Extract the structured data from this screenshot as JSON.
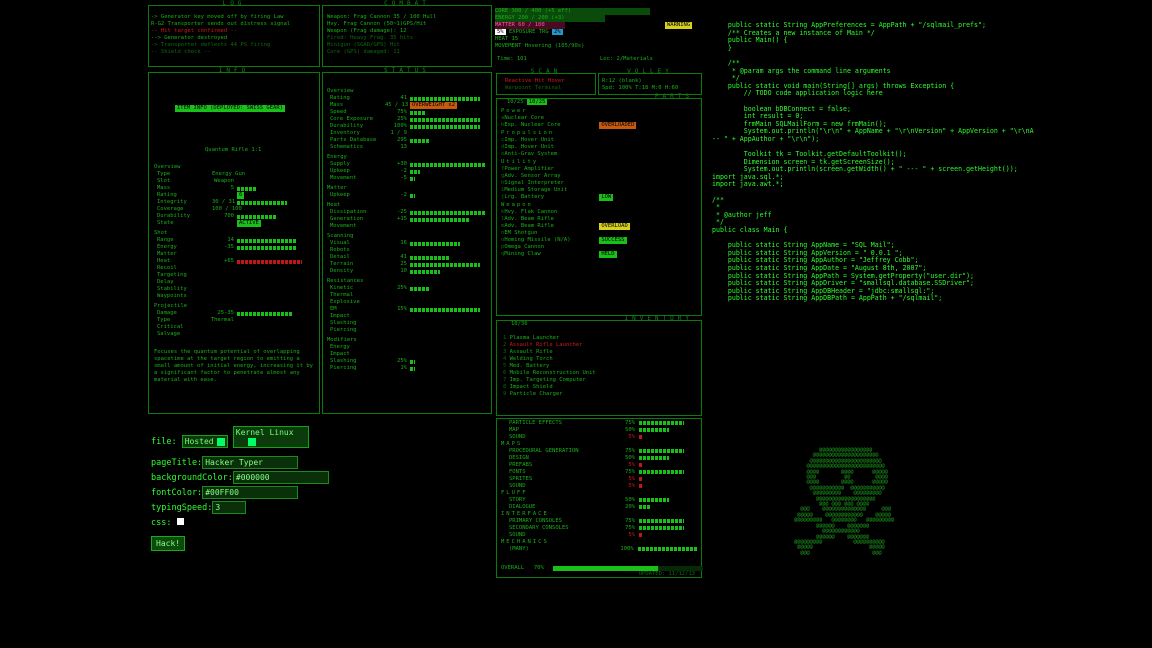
{
  "log": {
    "title": "LOG",
    "lines": [
      "-> Generator key moved off by firing Law",
      "R-G2 Transporter sends out distress signal",
      "-- Hit target confirmed --",
      "--> Generator destroyed",
      "-> Transporter deflects 44 PS firing",
      "-- Shield check --"
    ]
  },
  "combat": {
    "title": "COMBAT",
    "lines": [
      "Weapon: Frag Cannon 35 / 100 Hull",
      "Hvy. Frag Cannon (50~1)GPS/Hit",
      "Weapon (Frag damage): 12",
      "Fired: Heavy Frag. 35 hits",
      "Minigun (SGAD/GPS) Hit",
      "Core (GPS) damaged: 11"
    ]
  },
  "status_top": {
    "lines": [
      "CORE  300 / 400 (+5 eff)",
      "ENERGY 200 / 200 (+3)",
      "MATTER 60 / 100",
      "EXPOSURE  TRG",
      "HEAT  15",
      "MOVEMENT Hovering (105/90s)"
    ],
    "badge_5": "5%",
    "badge_2": "2%",
    "warning": "WARNING",
    "time": "Time: 101",
    "loc": "Loc: 2/Materials"
  },
  "scan": {
    "title": "SCAN",
    "lines": [
      "Reactive Hit Hover",
      "Warpoint Terminal"
    ]
  },
  "volley": {
    "title": "VOLLEY",
    "lines": [
      "R:12 (blank)",
      "Spd: 100%  T:18  M:0  H:60"
    ]
  },
  "info": {
    "title": "INFO",
    "badge": "ITEM INFO (DEPLOYED: SWISS GEAR)",
    "name": "Quantum Rifle 1:1",
    "overview_h": "Overview",
    "overview": [
      [
        "Type",
        "Energy Gun"
      ],
      [
        "Slot",
        "Weapon"
      ],
      [
        "Mass",
        "5"
      ],
      [
        "Rating",
        "6"
      ],
      [
        "Integrity",
        "30 / 31"
      ],
      [
        "Coverage",
        "100 / 100"
      ],
      [
        "Durability",
        "700"
      ],
      [
        "State",
        "ACTIVE"
      ]
    ],
    "shot_h": "Shot",
    "shot": [
      [
        "Range",
        "14"
      ],
      [
        "Energy",
        "-35"
      ],
      [
        "Matter",
        ""
      ],
      [
        "Heat",
        "+65"
      ],
      [
        "Recoil",
        ""
      ],
      [
        "Targeting",
        ""
      ],
      [
        "Delay",
        ""
      ],
      [
        "Stability",
        ""
      ],
      [
        "Waypoints",
        ""
      ]
    ],
    "projectile_h": "Projectile",
    "projectile": [
      [
        "Damage",
        "25-35"
      ],
      [
        "Type",
        "Thermal"
      ],
      [
        "Critical",
        ""
      ],
      [
        "Salvage",
        ""
      ]
    ],
    "desc": "Focuses the quantum potential of overlapping spacetime at the target region to emitting a small amount of initial energy, increasing it by a significant factor to penetrate almost any material with ease."
  },
  "status": {
    "title": "STATUS",
    "overview_h": "Overview",
    "overview": [
      [
        "Rating",
        "41"
      ],
      [
        "Mass",
        "45 / 13"
      ],
      [
        "Speed",
        "75%"
      ],
      [
        "Core Exposure",
        "25%"
      ],
      [
        "Durability",
        "100%"
      ],
      [
        "Inventory",
        "1 / 9"
      ],
      [
        "Parts Database",
        "295"
      ],
      [
        "Schematics",
        "13"
      ]
    ],
    "overweight": "OVERWEIGHT x2",
    "energy_h": "Energy",
    "energy": [
      [
        "Supply",
        "+30"
      ],
      [
        "Upkeep",
        "-2"
      ],
      [
        "Movement",
        "-5"
      ]
    ],
    "matter_h": "Matter",
    "matter": [
      [
        "Upkeep",
        "-2"
      ]
    ],
    "heat_h": "Heat",
    "heat": [
      [
        "Dissipation",
        "-25"
      ],
      [
        "Generation",
        "+15"
      ],
      [
        "Movement",
        ""
      ]
    ],
    "scanning_h": "Scanning",
    "scanning": [
      [
        "Visual",
        "16"
      ],
      [
        "Robots",
        ""
      ],
      [
        "Detail",
        "41"
      ],
      [
        "Terrain",
        "25"
      ],
      [
        "Density",
        "10"
      ]
    ],
    "resist_h": "Resistances",
    "resist": [
      [
        "Kinetic",
        "25%"
      ],
      [
        "Thermal",
        ""
      ],
      [
        "Explosive",
        ""
      ],
      [
        "EM",
        "15%"
      ],
      [
        "Impact",
        ""
      ],
      [
        "Slashing",
        ""
      ],
      [
        "Piercing",
        ""
      ]
    ],
    "mod_h": "Modifiers",
    "mod": [
      [
        "Energy",
        ""
      ],
      [
        "Impact",
        ""
      ],
      [
        "Slashing",
        "25%"
      ],
      [
        "Piercing",
        "1%"
      ]
    ]
  },
  "parts": {
    "title": "PARTS",
    "header": "10/25",
    "badge": "10/25",
    "power_h": "Power",
    "power": [
      [
        "Nuclear Core",
        ""
      ],
      [
        "Exp. Nuclear Core",
        "OVERLOADED"
      ]
    ],
    "prop_h": "Propulsion",
    "prop": [
      [
        "Imp. Hover Unit",
        ""
      ],
      [
        "Imp. Hover Unit",
        ""
      ],
      [
        "Anti-Grav System",
        ""
      ]
    ],
    "util_h": "Utility",
    "util": [
      [
        "Power Amplifier",
        ""
      ],
      [
        "Adv. Sensor Array",
        ""
      ],
      [
        "Signal Interpreter",
        ""
      ],
      [
        "Medium Storage Unit",
        ""
      ],
      [
        "Lrg. Battery",
        "LOW"
      ]
    ],
    "weap_h": "Weapon",
    "weap": [
      [
        "Hvy. Flak Cannon",
        ""
      ],
      [
        "Adv. Beam Rifle",
        ""
      ],
      [
        "Adv. Beam Rifle",
        "OVERLOAD"
      ],
      [
        "EM Shotgun",
        ""
      ],
      [
        "Homing Missile (N/A)",
        "SUCCESS"
      ],
      [
        "Omega Cannon",
        ""
      ],
      [
        "Mining Claw",
        "HELD"
      ]
    ]
  },
  "inventory": {
    "title": "INVENTORY",
    "header": "10/36",
    "items": [
      "Plasma Launcher",
      "Assault Rifle Launcher",
      "Assault Rifle",
      "Welding Torch",
      "Med. Battery",
      "Mobile Reconstruction Unit",
      "Imp. Targeting Computer",
      "Impact Shield",
      "Particle Charger"
    ]
  },
  "progress": {
    "sections": [
      {
        "h": "",
        "items": [
          [
            "PARTICLE EFFECTS",
            "75%"
          ],
          [
            "MAP",
            "50%"
          ],
          [
            "SOUND",
            "5%"
          ]
        ]
      },
      {
        "h": "MAPS",
        "items": [
          [
            "PROCEDURAL GENERATION",
            "75%"
          ],
          [
            "DESIGN",
            "50%"
          ],
          [
            "PREFABS",
            "5%"
          ],
          [
            "FONTS",
            "75%"
          ],
          [
            "SPRITES",
            "5%"
          ],
          [
            "SOUND",
            "5%"
          ]
        ]
      },
      {
        "h": "FLUFF",
        "items": [
          [
            "STORY",
            "50%"
          ],
          [
            "DIALOGUE",
            "20%"
          ]
        ]
      },
      {
        "h": "INTERFACE",
        "items": [
          [
            "PRIMARY CONSOLES",
            "75%"
          ],
          [
            "SECONDARY CONSOLES",
            "75%"
          ],
          [
            "SOUND",
            "5%"
          ]
        ]
      },
      {
        "h": "MECHANICS",
        "items": [
          [
            "(MANY)",
            "100%"
          ]
        ]
      }
    ],
    "overall_label": "OVERALL",
    "overall_value": "70%",
    "overall_fraction": 0.7,
    "footer": "UPDATED: 11/12/13"
  },
  "form": {
    "file_label": "file:",
    "file_value": "Hosted",
    "kernel_value": "Kernel Linux",
    "title_label": "pageTitle:",
    "title_value": "Hacker Typer",
    "bg_label": "backgroundColor:",
    "bg_value": "#000000",
    "font_label": "fontColor:",
    "font_value": "#00FF00",
    "speed_label": "typingSpeed:",
    "speed_value": "3",
    "css_label": "css:",
    "hack_label": "Hack!"
  },
  "code": "    public static String AppPreferences = AppPath + \"/sqlmail_prefs\";\n    /** Creates a new instance of Main */\n    public Main() {\n    }\n\n    /**\n     * @param args the command line arguments\n     */\n    public static void main(String[] args) throws Exception {\n        // TODO code application logic here\n\n        boolean bDBConnect = false;\n        int result = 0;\n        frmMain SQLMailForm = new frmMain();\n        System.out.println(\"\\r\\n\" + AppName + \"\\r\\nVersion\" + AppVersion + \"\\r\\nA\n-- \" + AppAuthor + \"\\r\\n\");\n\n        Toolkit tk = Toolkit.getDefaultToolkit();\n        Dimension screen = tk.getScreenSize();\n        System.out.println(screen.getWidth() + \" --- \" + screen.getHeight());\nimport java.sql.*;\nimport java.awt.*;\n\n/**\n *\n * @author jeff\n */\npublic class Main {\n\n    public static String AppName = \"SQL Mail\";\n    public static String AppVersion = \" 0.0.1 \";\n    public static String AppAuthor = \"Jeffrey Cobb\";\n    public static String AppDate = \"August 8th, 2007\";\n    public static String AppPath = System.getProperty(\"user.dir\");\n    public static String AppDriver = \"smallsql.database.SSDriver\";\n    public static String AppDBHeader = \"jdbc:smallsql:\";\n    public static String AppDBPath = AppPath + \"/sqlmail\";",
  "colors": {
    "accent": "#19c019",
    "code": "#2cff2c",
    "danger": "#d01818",
    "warning": "#c85a10",
    "yellow": "#d8d020"
  }
}
